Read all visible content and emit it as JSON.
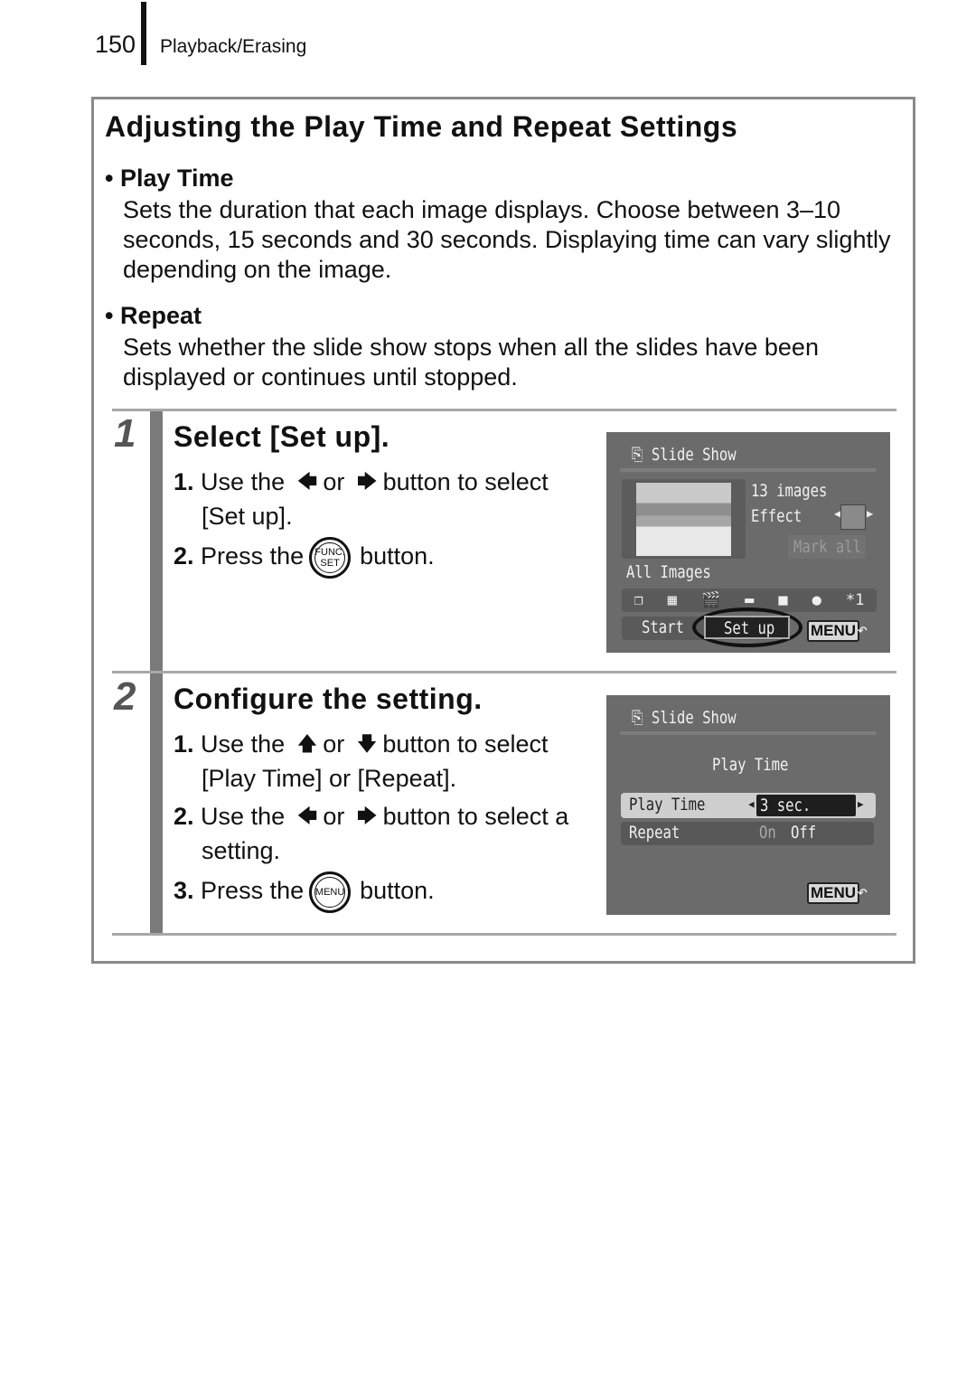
{
  "header": {
    "page_number": "150",
    "section": "Playback/Erasing"
  },
  "section": {
    "title": "Adjusting the Play Time and Repeat Settings",
    "bullets": [
      {
        "heading": "• Play Time",
        "text": "Sets the duration that each image displays. Choose between 3–10 seconds, 15 seconds and 30 seconds. Displaying time can vary slightly depending on the image."
      },
      {
        "heading": "• Repeat",
        "text": "Sets whether the slide show stops when all the slides have been displayed or continues until stopped."
      }
    ]
  },
  "steps": [
    {
      "number": "1",
      "heading": "Select [Set up].",
      "items": [
        {
          "num": "1.",
          "pre": "Use the",
          "icon1": "left-arrow",
          "mid": "or",
          "icon2": "right-arrow",
          "post": "button to select",
          "cont": "[Set up]."
        },
        {
          "num": "2.",
          "pre": "Press the",
          "button_label": "FUNC. SET",
          "post": "button."
        }
      ],
      "screen": {
        "title": "Slide Show",
        "image_count": "13 images",
        "effect_label": "Effect",
        "mark_all": "Mark all",
        "filter_label": "All Images",
        "start": "Start",
        "setup": "Set up",
        "menu": "MENU",
        "rotate_label": "*1"
      }
    },
    {
      "number": "2",
      "heading": "Configure the setting.",
      "items": [
        {
          "num": "1.",
          "pre": "Use the",
          "icon1": "up-arrow",
          "mid": "or",
          "icon2": "down-arrow",
          "post": "button to select",
          "cont": "[Play Time] or [Repeat]."
        },
        {
          "num": "2.",
          "pre": "Use the",
          "icon1": "left-arrow",
          "mid": "or",
          "icon2": "right-arrow",
          "post": "button to select a",
          "cont": "setting."
        },
        {
          "num": "3.",
          "pre": "Press the",
          "button_label": "MENU",
          "post": "button."
        }
      ],
      "screen": {
        "title": "Slide Show",
        "subtitle": "Play Time",
        "rows": [
          {
            "label": "Play Time",
            "value": "3 sec."
          },
          {
            "label": "Repeat",
            "value_on": "On",
            "value_off": "Off"
          }
        ],
        "menu": "MENU"
      }
    }
  ]
}
